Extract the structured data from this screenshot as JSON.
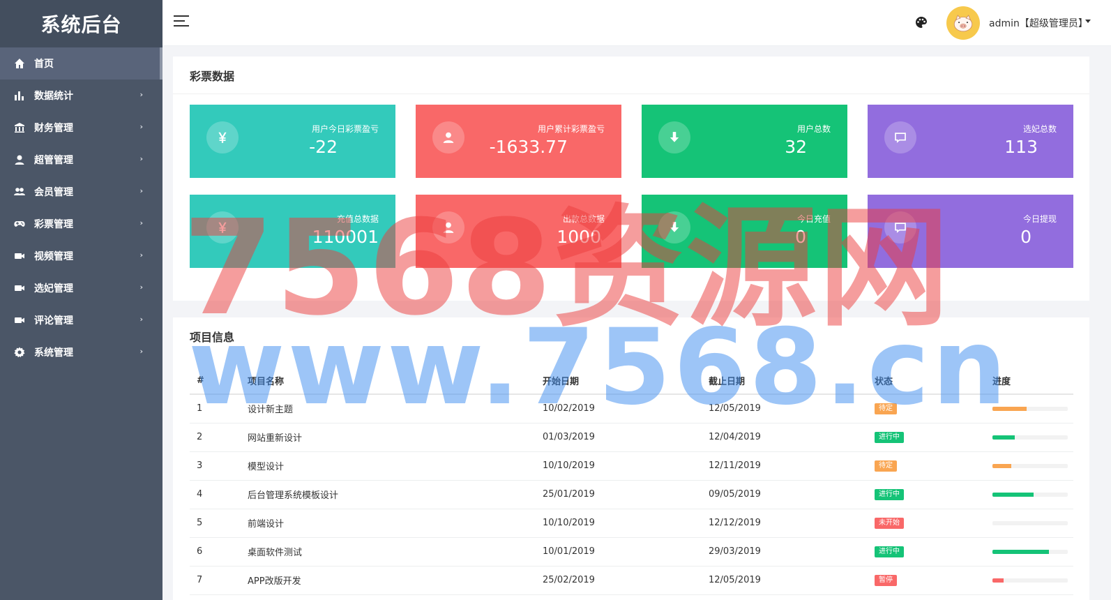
{
  "app": {
    "brand": "系统后台"
  },
  "sidebar": {
    "items": [
      {
        "label": "首页",
        "icon": "home-icon"
      },
      {
        "label": "数据统计",
        "icon": "bar-chart-icon"
      },
      {
        "label": "财务管理",
        "icon": "bank-icon"
      },
      {
        "label": "超管管理",
        "icon": "user-icon"
      },
      {
        "label": "会员管理",
        "icon": "users-icon"
      },
      {
        "label": "彩票管理",
        "icon": "gamepad-icon"
      },
      {
        "label": "视频管理",
        "icon": "video-icon"
      },
      {
        "label": "选妃管理",
        "icon": "video-icon"
      },
      {
        "label": "评论管理",
        "icon": "video-icon"
      },
      {
        "label": "系统管理",
        "icon": "gear-icon"
      }
    ]
  },
  "topbar": {
    "user": "admin【超级管理员】"
  },
  "stats": {
    "title": "彩票数据",
    "cards": [
      {
        "label": "用户今日彩票盈亏",
        "value": "-22",
        "icon": "yen-icon",
        "color": "#33cabb"
      },
      {
        "label": "用户累计彩票盈亏",
        "value": "-1633.77",
        "icon": "user-icon",
        "color": "#f96868"
      },
      {
        "label": "用户总数",
        "value": "32",
        "icon": "download-icon",
        "color": "#15c377"
      },
      {
        "label": "选妃总数",
        "value": "113",
        "icon": "comment-icon",
        "color": "#926dde"
      },
      {
        "label": "充值总数据",
        "value": "110001",
        "icon": "yen-icon",
        "color": "#33cabb"
      },
      {
        "label": "出款总数据",
        "value": "1000",
        "icon": "user-icon",
        "color": "#f96868"
      },
      {
        "label": "今日充值",
        "value": "0",
        "icon": "download-icon",
        "color": "#15c377"
      },
      {
        "label": "今日提现",
        "value": "0",
        "icon": "comment-icon",
        "color": "#926dde"
      }
    ]
  },
  "projects": {
    "title": "项目信息",
    "headers": [
      "#",
      "项目名称",
      "开始日期",
      "截止日期",
      "状态",
      "进度"
    ],
    "rows": [
      {
        "id": "1",
        "name": "设计新主题",
        "start": "10/02/2019",
        "end": "12/05/2019",
        "status": "待定",
        "status_color": "#f9a551",
        "progress": 45,
        "progress_color": "#f9a551"
      },
      {
        "id": "2",
        "name": "网站重新设计",
        "start": "01/03/2019",
        "end": "12/04/2019",
        "status": "进行中",
        "status_color": "#15c377",
        "progress": 30,
        "progress_color": "#15c377"
      },
      {
        "id": "3",
        "name": "模型设计",
        "start": "10/10/2019",
        "end": "12/11/2019",
        "status": "待定",
        "status_color": "#f9a551",
        "progress": 25,
        "progress_color": "#f9a551"
      },
      {
        "id": "4",
        "name": "后台管理系统模板设计",
        "start": "25/01/2019",
        "end": "09/05/2019",
        "status": "进行中",
        "status_color": "#15c377",
        "progress": 55,
        "progress_color": "#15c377"
      },
      {
        "id": "5",
        "name": "前端设计",
        "start": "10/10/2019",
        "end": "12/12/2019",
        "status": "未开始",
        "status_color": "#f96868",
        "progress": 0,
        "progress_color": "#f96868"
      },
      {
        "id": "6",
        "name": "桌面软件测试",
        "start": "10/01/2019",
        "end": "29/03/2019",
        "status": "进行中",
        "status_color": "#15c377",
        "progress": 75,
        "progress_color": "#15c377"
      },
      {
        "id": "7",
        "name": "APP改版开发",
        "start": "25/02/2019",
        "end": "12/05/2019",
        "status": "暂停",
        "status_color": "#f96868",
        "progress": 15,
        "progress_color": "#f96868"
      }
    ]
  },
  "watermark": {
    "line1": "7568资源网",
    "line2": "www.7568.cn"
  }
}
